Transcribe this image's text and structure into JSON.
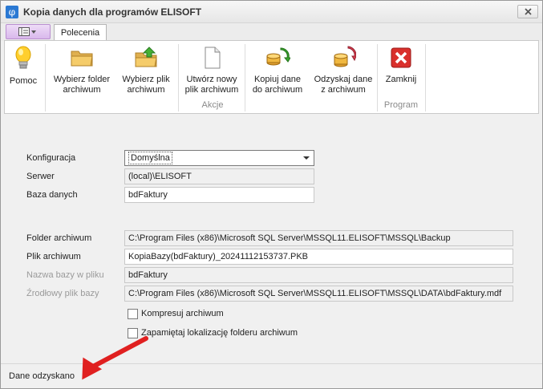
{
  "window": {
    "title": "Kopia danych dla programów ELISOFT",
    "icon_glyph": "φ"
  },
  "tabs": [
    {
      "label": "Polecenia",
      "active": true
    }
  ],
  "ribbon": {
    "buttons": [
      {
        "id": "help",
        "label": "Pomoc",
        "icon": "lightbulb-icon"
      },
      {
        "id": "choose-folder",
        "label": "Wybierz folder archiwum",
        "icon": "folder-icon"
      },
      {
        "id": "choose-file",
        "label": "Wybierz plik archiwum",
        "icon": "folder-up-icon"
      },
      {
        "id": "create-file",
        "label": "Utwórz nowy plik archiwum",
        "icon": "new-file-icon"
      },
      {
        "id": "backup",
        "label": "Kopiuj dane do archiwum",
        "icon": "db-backup-icon"
      },
      {
        "id": "restore",
        "label": "Odzyskaj dane z archiwum",
        "icon": "db-restore-icon"
      },
      {
        "id": "close",
        "label": "Zamknij",
        "icon": "close-red-icon"
      }
    ],
    "groups": {
      "actions": "Akcje",
      "program": "Program"
    }
  },
  "form": {
    "konfiguracja": {
      "label": "Konfiguracja",
      "value": "Domyślna"
    },
    "serwer": {
      "label": "Serwer",
      "value": "(local)\\ELISOFT"
    },
    "baza": {
      "label": "Baza danych",
      "value": "bdFaktury"
    },
    "folder": {
      "label": "Folder archiwum",
      "value": "C:\\Program Files (x86)\\Microsoft SQL Server\\MSSQL11.ELISOFT\\MSSQL\\Backup"
    },
    "plik": {
      "label": "Plik archiwum",
      "value": "KopiaBazy(bdFaktury)_20241112153737.PKB"
    },
    "nazwa": {
      "label": "Nazwa bazy w pliku",
      "value": "bdFaktury"
    },
    "zrodlowy": {
      "label": "Źrodłowy plik bazy",
      "value": "C:\\Program Files (x86)\\Microsoft SQL Server\\MSSQL11.ELISOFT\\MSSQL\\DATA\\bdFaktury.mdf"
    },
    "kompresuj": {
      "label": "Kompresuj archiwum",
      "checked": false
    },
    "zapamietaj": {
      "label": "Zapamiętaj lokalizację folderu archiwum",
      "checked": false
    }
  },
  "status": {
    "text": "Dane odzyskano"
  },
  "colors": {
    "accent": "#2b79d3",
    "arrow": "#e02020",
    "close_red": "#d9302c"
  }
}
